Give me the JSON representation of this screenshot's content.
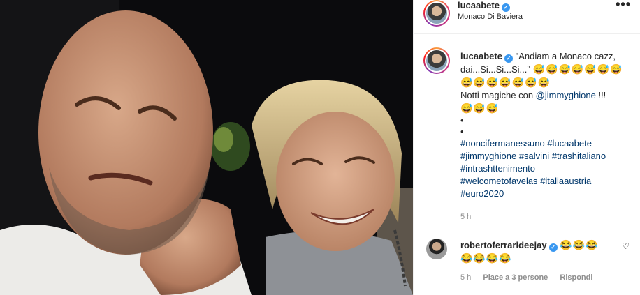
{
  "post": {
    "username": "lucaabete",
    "location": "Monaco Di Baviera",
    "more_label": "•••"
  },
  "caption": {
    "username": "lucaabete",
    "text_line1": "\"Andiam a Monaco cazz, dai...Si...Si...Si...\"",
    "emoji_line1": "😅😅😅😅😅😅😅",
    "emoji_line2": "😅😅😅😅😅😅😅",
    "notti_text": "Notti magiche con ",
    "mention": "@jimmyghione",
    "notti_suffix": " !!!",
    "emoji_line3": "😅😅😅",
    "bullet1": "•",
    "bullet2": "•",
    "hashtags": [
      "#noncifermanessuno",
      "#lucaabete",
      "#jimmyghione",
      "#salvini",
      "#trashitaliano",
      "#intrashttenimento",
      "#welcometofavelas",
      "#italiaaustria",
      "#euro2020"
    ],
    "time": "5 h"
  },
  "comment": {
    "username": "robertoferrarideejay",
    "emoji_line1": "😂😂😂",
    "emoji_line2": "😂😂😂😂",
    "time": "5 h",
    "likes": "Piace a 3 persone",
    "reply": "Rispondi",
    "heart_icon": "heart-outline-icon"
  }
}
